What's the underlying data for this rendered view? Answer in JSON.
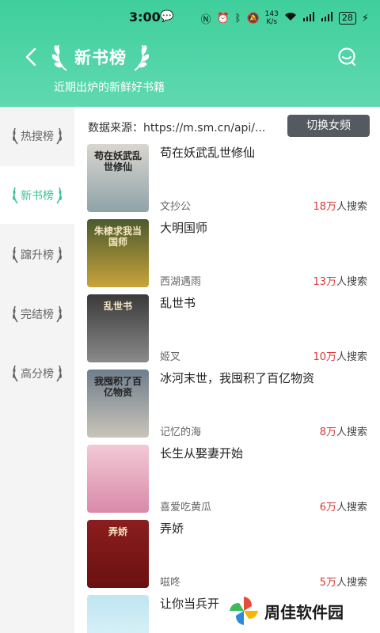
{
  "status_bar": {
    "time": "3:00",
    "speed_top": "143",
    "speed_bottom": "K/s",
    "battery": "28"
  },
  "header": {
    "title": "新书榜",
    "subtitle": "近期出炉的新鲜好书籍"
  },
  "sidebar": {
    "items": [
      {
        "label": "热搜榜"
      },
      {
        "label": "新书榜"
      },
      {
        "label": "蹿升榜"
      },
      {
        "label": "完结榜"
      },
      {
        "label": "高分榜"
      }
    ]
  },
  "main": {
    "source_text": "数据来源：https://m.sm.cn/api/...",
    "switch_label": "切换女频"
  },
  "books": [
    {
      "title": "苟在妖武乱世修仙",
      "author": "文抄公",
      "count": "18万",
      "suffix": "人搜索",
      "cover_text": "苟在妖武乱世修仙",
      "cover_colors": [
        "#d9d6cf",
        "#8fa3a8"
      ]
    },
    {
      "title": "大明国师",
      "author": "西湖遇雨",
      "count": "13万",
      "suffix": "人搜索",
      "cover_text": "朱棣求我当国师",
      "cover_colors": [
        "#4a5a2e",
        "#c9a33a"
      ]
    },
    {
      "title": "乱世书",
      "author": "姬叉",
      "count": "10万",
      "suffix": "人搜索",
      "cover_text": "乱世书",
      "cover_colors": [
        "#3a3a3a",
        "#8a8a8a"
      ]
    },
    {
      "title": "冰河末世，我囤积了百亿物资",
      "author": "记忆的海",
      "count": "8万",
      "suffix": "人搜索",
      "cover_text": "我囤积了百亿物资",
      "cover_colors": [
        "#6f7e8c",
        "#c9c4b8"
      ]
    },
    {
      "title": "长生从娶妻开始",
      "author": "喜爱吃黄瓜",
      "count": "6万",
      "suffix": "人搜索",
      "cover_text": "",
      "cover_colors": [
        "#f3c9d6",
        "#d98aa8"
      ]
    },
    {
      "title": "弄娇",
      "author": "嗞咚",
      "count": "5万",
      "suffix": "人搜索",
      "cover_text": "弄娇",
      "cover_colors": [
        "#8b1e1e",
        "#6a1010"
      ]
    },
    {
      "title": "让你当兵开",
      "author": "",
      "count": "",
      "suffix": "",
      "cover_text": "",
      "cover_colors": [
        "#bfe6f2",
        "#e8f6fa"
      ]
    }
  ],
  "watermark": {
    "text": "周佳软件园"
  },
  "colors": {
    "accent": "#3cc496",
    "header_start": "#3fcf9c",
    "header_end": "#5fd9b0",
    "search_count": "#d83a3a"
  }
}
